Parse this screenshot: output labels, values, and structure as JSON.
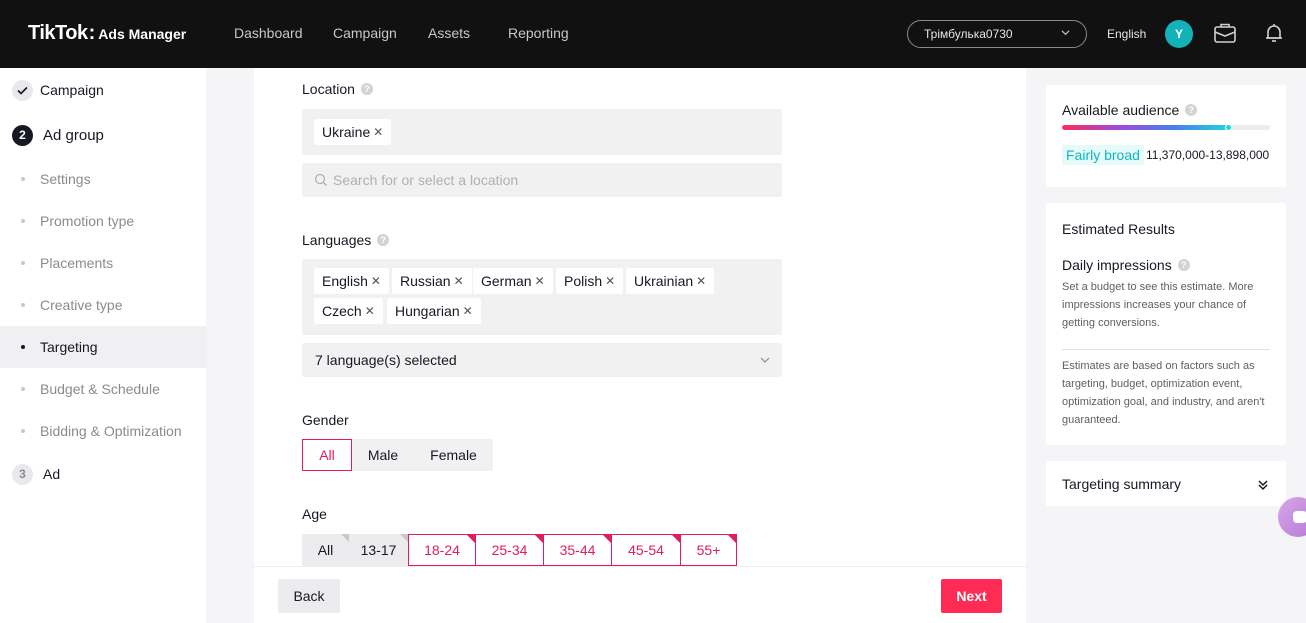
{
  "header": {
    "logo_main": "TikTok",
    "logo_colon": ":",
    "logo_sub": "Ads Manager",
    "nav": [
      "Dashboard",
      "Campaign",
      "Assets",
      "Reporting"
    ],
    "account": "Трімбулька0730",
    "language": "English",
    "avatar_initial": "Y"
  },
  "sidebar": {
    "step1_label": "Campaign",
    "step2_number": "2",
    "step2_label": "Ad group",
    "sub_items": [
      "Settings",
      "Promotion type",
      "Placements",
      "Creative type",
      "Targeting",
      "Budget & Schedule",
      "Bidding & Optimization"
    ],
    "active_sub_item": "Targeting",
    "step3_number": "3",
    "step3_label": "Ad"
  },
  "form": {
    "location_label": "Location",
    "location_tags": [
      "Ukraine"
    ],
    "location_placeholder": "Search for or select a location",
    "languages_label": "Languages",
    "language_tags": [
      "English",
      "Russian",
      "German",
      "Polish",
      "Ukrainian",
      "Czech",
      "Hungarian"
    ],
    "languages_selected": "7 language(s) selected",
    "gender_label": "Gender",
    "gender_options": [
      "All",
      "Male",
      "Female"
    ],
    "gender_selected": "All",
    "age_label": "Age",
    "age_options": [
      "All",
      "13-17",
      "18-24",
      "25-34",
      "35-44",
      "45-54",
      "55+"
    ],
    "age_selected": [
      "18-24",
      "25-34",
      "35-44",
      "45-54",
      "55+"
    ]
  },
  "footer": {
    "back_label": "Back",
    "next_label": "Next"
  },
  "audience": {
    "title": "Available audience",
    "level_fraction": 0.8,
    "badge": "Fairly broad",
    "range": "11,370,000-13,898,000"
  },
  "estimates": {
    "title": "Estimated Results",
    "metric": "Daily impressions",
    "metric_desc": "Set a budget to see this estimate. More impressions increases your chance of getting conversions.",
    "disclaimer": "Estimates are based on factors such as targeting, budget, optimization event, optimization goal, and industry, and aren't guaranteed."
  },
  "summary": {
    "title": "Targeting summary"
  },
  "colors": {
    "accent": "#fe2c55",
    "selected_border": "#e01e5a",
    "teal": "#12b2b8",
    "topbar": "#111111"
  },
  "icons": {
    "help": "question-circle-icon",
    "search": "search-icon",
    "chevron": "chevron-down-icon",
    "check": "check-icon",
    "briefcase": "briefcase-icon",
    "bell": "bell-icon",
    "double_chevron": "double-chevron-down-icon",
    "chat": "chat-bubble-icon"
  }
}
